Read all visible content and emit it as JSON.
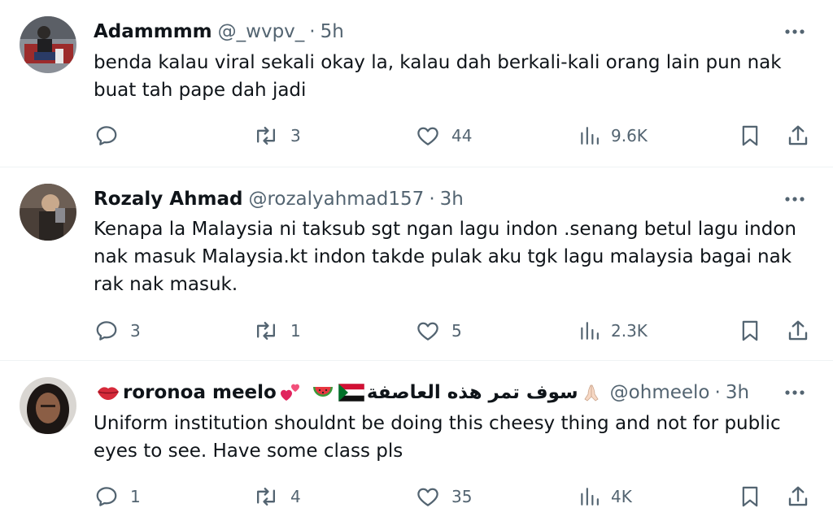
{
  "replies": [
    {
      "name": "Adammmm",
      "handle": "@_wvpv_",
      "dot": "·",
      "time": "5h",
      "text_lines": [
        "benda kalau viral sekali okay la, kalau dah berkali-kali orang lain pun nak",
        "buat tah pape dah jadi"
      ],
      "replies_count": "",
      "reposts": "3",
      "likes": "44",
      "views": "9.6K"
    },
    {
      "name": "Rozaly Ahmad",
      "handle": "@rozalyahmad157",
      "dot": "·",
      "time": "3h",
      "text_lines": [
        "Kenapa la Malaysia ni taksub sgt ngan lagu indon .senang betul lagu indon",
        "nak masuk Malaysia.kt indon takde pulak aku tgk lagu malaysia bagai nak",
        "rak nak masuk."
      ],
      "replies_count": "3",
      "reposts": "1",
      "likes": "5",
      "views": "2.3K"
    },
    {
      "name": "roronoa meelo",
      "name_arabic": "سوف تمر هذه العاصفة",
      "handle": "@ohmeelo",
      "dot": "·",
      "time": "3h",
      "text_lines": [
        "Uniform institution shouldnt be doing this cheesy thing and not for public",
        "eyes to see. Have some class pls"
      ],
      "replies_count": "1",
      "reposts": "4",
      "likes": "35",
      "views": "4K"
    }
  ],
  "icons": {
    "reply": "reply-icon",
    "repost": "repost-icon",
    "like": "heart-icon",
    "views": "views-icon",
    "bookmark": "bookmark-icon",
    "share": "share-icon",
    "more": "more-icon"
  },
  "colors": {
    "text": "#0f1419",
    "secondary": "#536471",
    "divider": "#eff3f4"
  }
}
